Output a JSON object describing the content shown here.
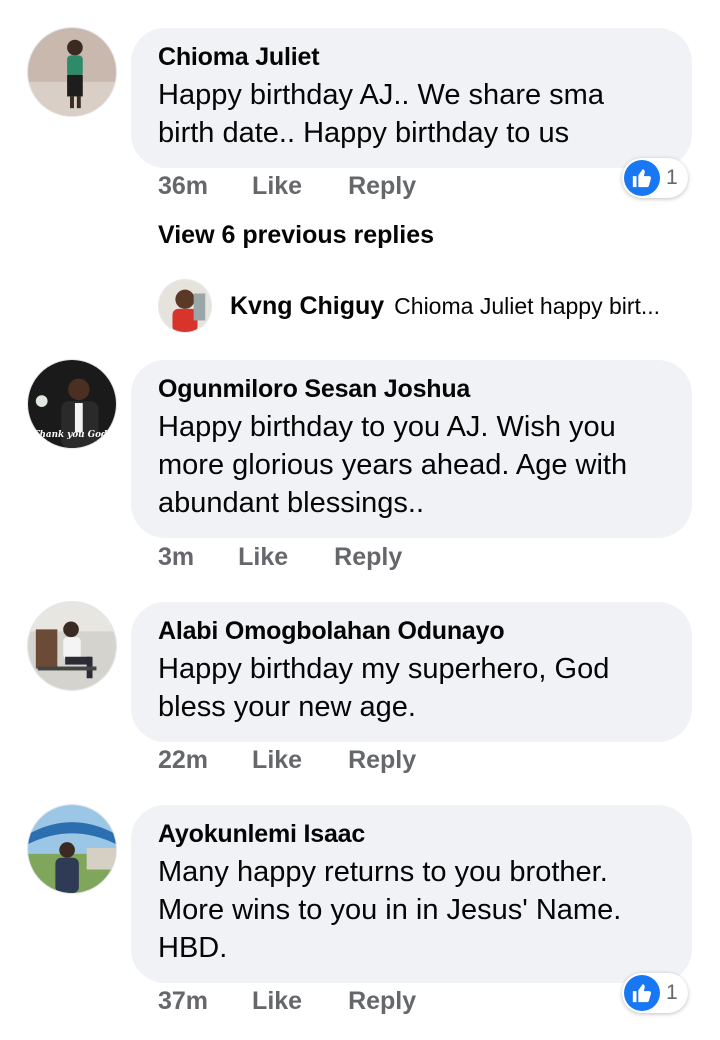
{
  "colors": {
    "bubble_bg": "#f0f2f5",
    "meta_text": "#65676b",
    "like_blue": "#1877f2"
  },
  "comments": [
    {
      "author": "Chioma Juliet",
      "text": "Happy birthday AJ.. We share sma birth date.. Happy birthday to us",
      "time": "36m",
      "like_label": "Like",
      "reply_label": "Reply",
      "reaction_count": "1"
    },
    {
      "author": "Ogunmiloro Sesan Joshua",
      "text": "Happy birthday to you AJ. Wish you more glorious years ahead. Age with abundant blessings..",
      "time": "3m",
      "like_label": "Like",
      "reply_label": "Reply",
      "avatar_caption": "Thank you God!"
    },
    {
      "author": "Alabi Omogbolahan Odunayo",
      "text": "Happy birthday my superhero, God bless your new age.",
      "time": "22m",
      "like_label": "Like",
      "reply_label": "Reply"
    },
    {
      "author": "Ayokunlemi Isaac",
      "text": "Many happy returns to you brother. More wins to you in in Jesus' Name. HBD.",
      "time": "37m",
      "like_label": "Like",
      "reply_label": "Reply",
      "reaction_count": "1"
    }
  ],
  "view_previous_replies": "View 6 previous replies",
  "reply_preview": {
    "author": "Kvng Chiguy",
    "text": "Chioma Juliet happy birt..."
  },
  "icons": {
    "reaction": "like-thumb-icon"
  }
}
